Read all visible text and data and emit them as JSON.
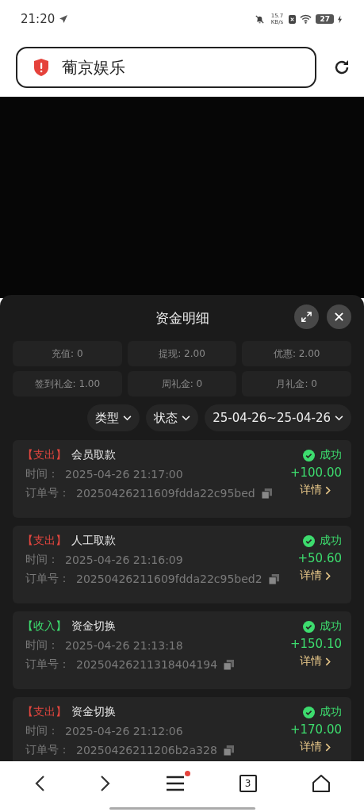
{
  "status_bar": {
    "time": "21:20",
    "net_speed": "15.7 KB/s",
    "battery": "27"
  },
  "address_bar": {
    "title": "葡京娱乐"
  },
  "sheet": {
    "title": "资金明细",
    "summary": [
      {
        "label": "充值: 0"
      },
      {
        "label": "提现: 2.00"
      },
      {
        "label": "优惠: 2.00"
      },
      {
        "label": "签到礼金: 1.00"
      },
      {
        "label": "周礼金: 0"
      },
      {
        "label": "月礼金: 0"
      }
    ],
    "filters": [
      {
        "label": "类型"
      },
      {
        "label": "状态"
      },
      {
        "label": "25-04-26~25-04-26"
      }
    ],
    "records": [
      {
        "kind": "expense",
        "tag": "【支出】",
        "title": "会员取款",
        "time_label": "时间：",
        "time": "2025-04-26 21:17:00",
        "order_label": "订单号：",
        "order": "20250426211609fdda22c95bed",
        "status": "成功",
        "amount": "+100.00",
        "detail": "详情"
      },
      {
        "kind": "expense",
        "tag": "【支出】",
        "title": "人工取款",
        "time_label": "时间：",
        "time": "2025-04-26 21:16:09",
        "order_label": "订单号：",
        "order": "20250426211609fdda22c95bed2",
        "status": "成功",
        "amount": "+50.60",
        "detail": "详情"
      },
      {
        "kind": "income",
        "tag": "【收入】",
        "title": "资金切换",
        "time_label": "时间：",
        "time": "2025-04-26 21:13:18",
        "order_label": "订单号：",
        "order": "20250426211318404194",
        "status": "成功",
        "amount": "+150.10",
        "detail": "详情"
      },
      {
        "kind": "expense",
        "tag": "【支出】",
        "title": "资金切换",
        "time_label": "时间：",
        "time": "2025-04-26 21:12:06",
        "order_label": "订单号：",
        "order": "20250426211206b2a328",
        "status": "成功",
        "amount": "+170.00",
        "detail": "详情"
      }
    ]
  },
  "bottom_nav": {
    "tab_count": "3",
    "menu_badge": true
  }
}
